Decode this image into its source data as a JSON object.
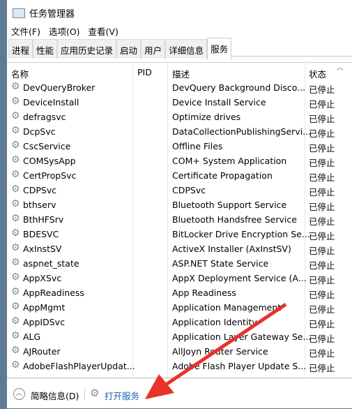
{
  "window": {
    "title": "任务管理器",
    "icon": "task-manager-icon"
  },
  "menu": [
    "文件(F)",
    "选项(O)",
    "查看(V)"
  ],
  "tabs": [
    {
      "label": "进程"
    },
    {
      "label": "性能"
    },
    {
      "label": "应用历史记录"
    },
    {
      "label": "启动"
    },
    {
      "label": "用户"
    },
    {
      "label": "详细信息"
    },
    {
      "label": "服务",
      "active": true
    }
  ],
  "columns": {
    "name": "名称",
    "pid": "PID",
    "desc": "描述",
    "status": "状态"
  },
  "rows": [
    [
      "DevQueryBroker",
      "",
      "DevQuery Background Disco...",
      "已停止"
    ],
    [
      "DeviceInstall",
      "",
      "Device Install Service",
      "已停止"
    ],
    [
      "defragsvc",
      "",
      "Optimize drives",
      "已停止"
    ],
    [
      "DcpSvc",
      "",
      "DataCollectionPublishingServi...",
      "已停止"
    ],
    [
      "CscService",
      "",
      "Offline Files",
      "已停止"
    ],
    [
      "COMSysApp",
      "",
      "COM+ System Application",
      "已停止"
    ],
    [
      "CertPropSvc",
      "",
      "Certificate Propagation",
      "已停止"
    ],
    [
      "CDPSvc",
      "",
      "CDPSvc",
      "已停止"
    ],
    [
      "bthserv",
      "",
      "Bluetooth Support Service",
      "已停止"
    ],
    [
      "BthHFSrv",
      "",
      "Bluetooth Handsfree Service",
      "已停止"
    ],
    [
      "BDESVC",
      "",
      "BitLocker Drive Encryption Se...",
      "已停止"
    ],
    [
      "AxInstSV",
      "",
      "ActiveX Installer (AxInstSV)",
      "已停止"
    ],
    [
      "aspnet_state",
      "",
      "ASP.NET State Service",
      "已停止"
    ],
    [
      "AppXSvc",
      "",
      "AppX Deployment Service (A...",
      "已停止"
    ],
    [
      "AppReadiness",
      "",
      "App Readiness",
      "已停止"
    ],
    [
      "AppMgmt",
      "",
      "Application Management",
      "已停止"
    ],
    [
      "AppIDSvc",
      "",
      "Application Identity",
      "已停止"
    ],
    [
      "ALG",
      "",
      "Application Layer Gateway Se...",
      "已停止"
    ],
    [
      "AJRouter",
      "",
      "AllJoyn Router Service",
      "已停止"
    ],
    [
      "AdobeFlashPlayerUpdat...",
      "",
      "Adobe Flash Player Update S...",
      "已停止"
    ]
  ],
  "footer": {
    "fewer_details": "简略信息(D)",
    "open_services": "打开服务"
  },
  "colors": {
    "link": "#1a5fb4",
    "arrow": "#e8322a"
  }
}
